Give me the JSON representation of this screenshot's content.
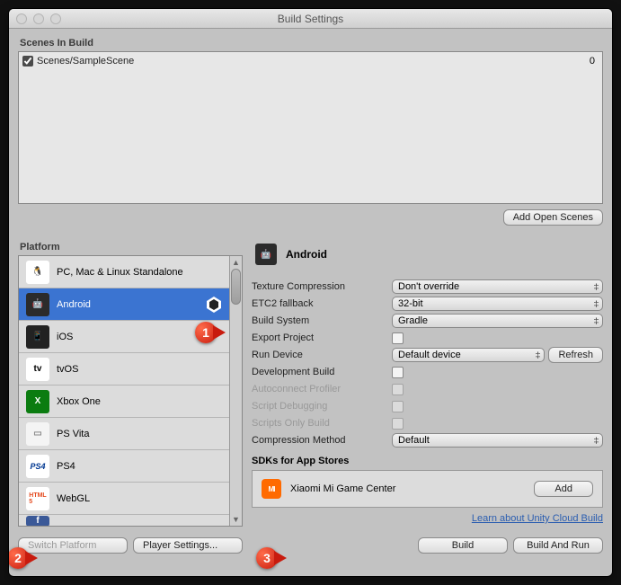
{
  "title": "Build Settings",
  "scenes": {
    "label": "Scenes In Build",
    "items": [
      {
        "name": "Scenes/SampleScene",
        "index": "0",
        "checked": true
      }
    ],
    "add_btn": "Add Open Scenes"
  },
  "platform": {
    "label": "Platform",
    "items": [
      {
        "id": "pc",
        "label": "PC, Mac & Linux Standalone"
      },
      {
        "id": "android",
        "label": "Android",
        "selected": true,
        "unity": true
      },
      {
        "id": "ios",
        "label": "iOS"
      },
      {
        "id": "tvos",
        "label": "tvOS"
      },
      {
        "id": "xbox",
        "label": "Xbox One"
      },
      {
        "id": "psvita",
        "label": "PS Vita"
      },
      {
        "id": "ps4",
        "label": "PS4"
      },
      {
        "id": "webgl",
        "label": "WebGL"
      }
    ]
  },
  "detail": {
    "title": "Android",
    "rows": {
      "texture": {
        "label": "Texture Compression",
        "value": "Don't override"
      },
      "etc2": {
        "label": "ETC2 fallback",
        "value": "32-bit"
      },
      "buildsys": {
        "label": "Build System",
        "value": "Gradle"
      },
      "export": {
        "label": "Export Project"
      },
      "rundev": {
        "label": "Run Device",
        "value": "Default device",
        "refresh": "Refresh"
      },
      "devbuild": {
        "label": "Development Build"
      },
      "autop": {
        "label": "Autoconnect Profiler"
      },
      "scriptdbg": {
        "label": "Script Debugging"
      },
      "scriptsonly": {
        "label": "Scripts Only Build"
      },
      "compression": {
        "label": "Compression Method",
        "value": "Default"
      }
    },
    "sdk": {
      "label": "SDKs for App Stores",
      "name": "Xiaomi Mi Game Center",
      "add": "Add"
    },
    "cloud": "Learn about Unity Cloud Build"
  },
  "bottom": {
    "switch": "Switch Platform",
    "player": "Player Settings...",
    "build": "Build",
    "buildrun": "Build And Run"
  },
  "callouts": {
    "1": "1",
    "2": "2",
    "3": "3"
  }
}
